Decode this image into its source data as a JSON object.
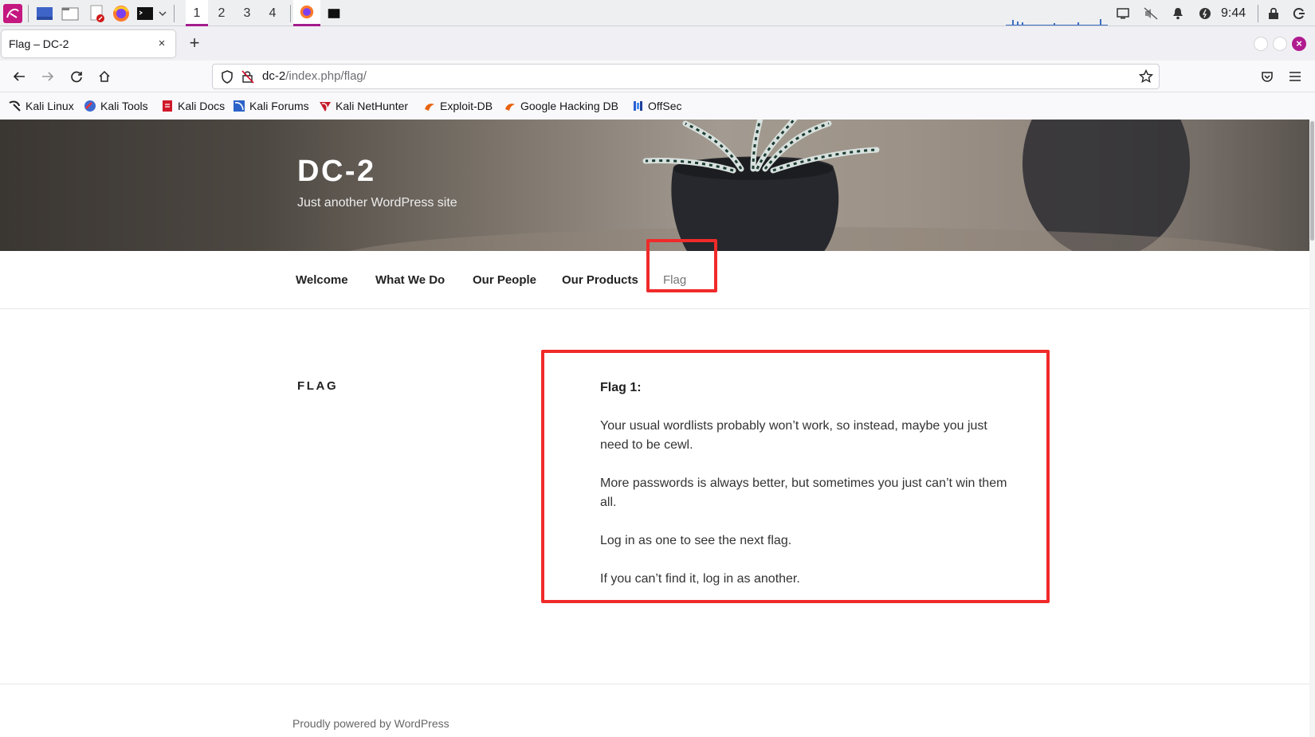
{
  "taskbar": {
    "workspaces": [
      "1",
      "2",
      "3",
      "4"
    ],
    "clock": "9:44"
  },
  "browser": {
    "tab_title": "Flag – DC-2",
    "tab_close": "×",
    "new_tab": "+",
    "url_host": "dc-2",
    "url_path": "/index.php/flag/",
    "bookmarks": [
      "Kali Linux",
      "Kali Tools",
      "Kali Docs",
      "Kali Forums",
      "Kali NetHunter",
      "Exploit-DB",
      "Google Hacking DB",
      "OffSec"
    ]
  },
  "site": {
    "title": "DC-2",
    "description": "Just another WordPress site",
    "menu": [
      "Welcome",
      "What We Do",
      "Our People",
      "Our Products",
      "Flag"
    ]
  },
  "page": {
    "heading": "FLAG",
    "paragraphs": [
      "Flag 1:",
      "Your usual wordlists probably won’t work, so instead, maybe you just need to be cewl.",
      "More passwords is always better, but sometimes you just can’t win them all.",
      "Log in as one to see the next flag.",
      "If you can’t find it, log in as another."
    ]
  },
  "footer": {
    "powered_by": "Proudly powered by WordPress"
  },
  "colors": {
    "highlight": "#f02a2a",
    "kali_accent": "#a51d8e"
  }
}
